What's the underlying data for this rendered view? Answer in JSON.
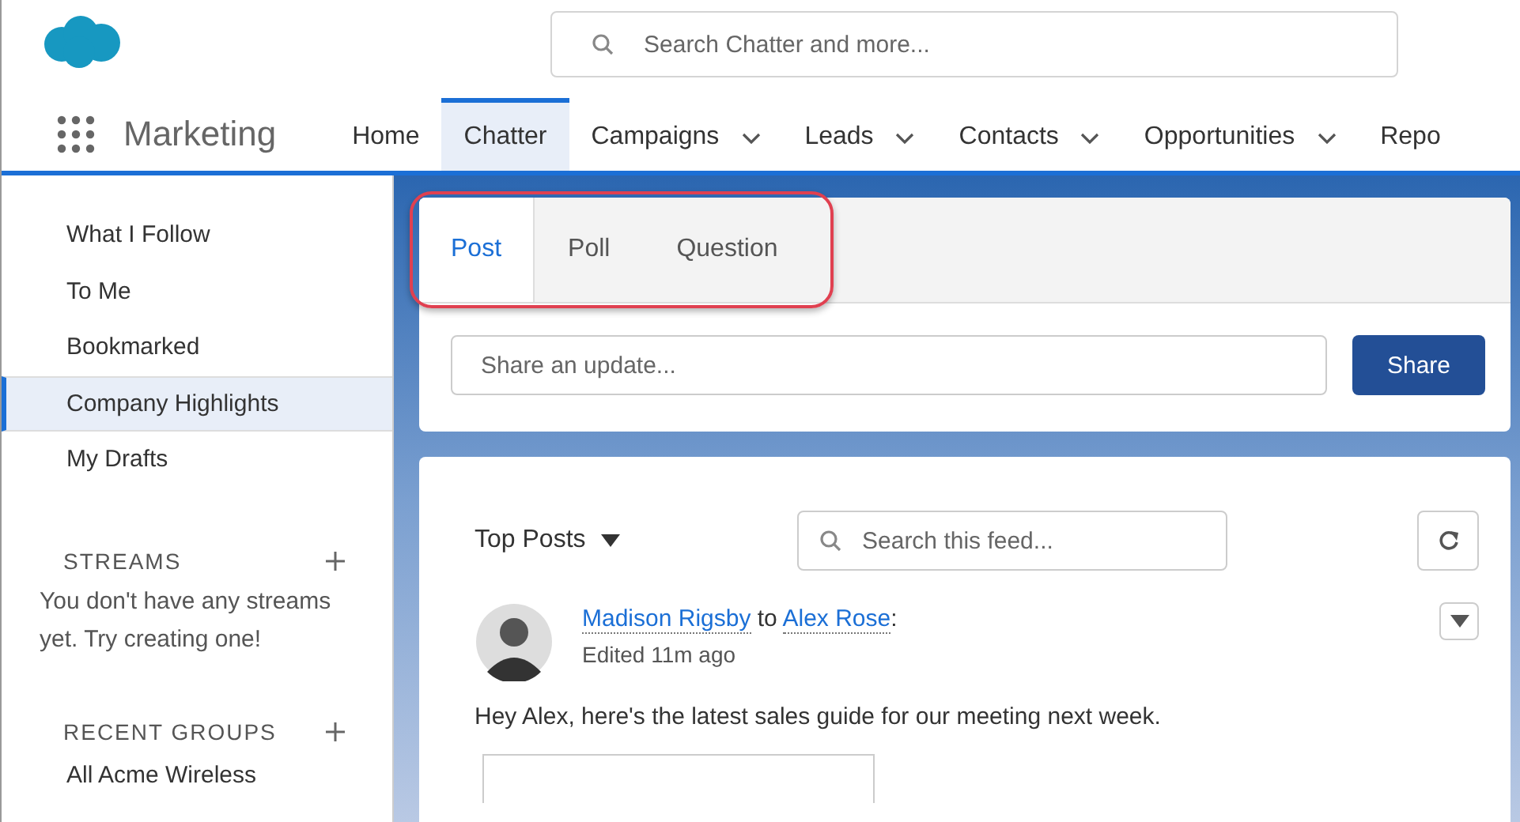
{
  "header": {
    "search": {
      "placeholder": "Search Chatter and more..."
    }
  },
  "app": {
    "name": "Marketing"
  },
  "nav": [
    {
      "label": "Home",
      "selected": false,
      "has_menu": false
    },
    {
      "label": "Chatter",
      "selected": true,
      "has_menu": false
    },
    {
      "label": "Campaigns",
      "selected": false,
      "has_menu": true
    },
    {
      "label": "Leads",
      "selected": false,
      "has_menu": true
    },
    {
      "label": "Contacts",
      "selected": false,
      "has_menu": true
    },
    {
      "label": "Opportunities",
      "selected": false,
      "has_menu": true
    },
    {
      "label": "Repo",
      "selected": false,
      "has_menu": false
    }
  ],
  "sidebar": {
    "items": [
      {
        "label": "What I Follow",
        "selected": false
      },
      {
        "label": "To Me",
        "selected": false
      },
      {
        "label": "Bookmarked",
        "selected": false
      },
      {
        "label": "Company Highlights",
        "selected": true
      },
      {
        "label": "My Drafts",
        "selected": false
      }
    ],
    "sections": [
      {
        "title": "STREAMS",
        "text": "You don't have any streams yet. Try creating one!"
      },
      {
        "title": "RECENT GROUPS",
        "items": [
          "All Acme Wireless"
        ]
      }
    ]
  },
  "publisher": {
    "tabs": [
      {
        "label": "Post",
        "selected": true
      },
      {
        "label": "Poll",
        "selected": false
      },
      {
        "label": "Question",
        "selected": false
      }
    ],
    "input": {
      "placeholder": "Share an update..."
    },
    "button": "Share"
  },
  "feed": {
    "sort": "Top Posts",
    "search": {
      "placeholder": "Search this feed..."
    },
    "posts": [
      {
        "author": "Madison Rigsby",
        "connector": "to",
        "recipient": "Alex Rose",
        "suffix": ":",
        "meta": "Edited 11m ago",
        "body": "Hey Alex, here's the latest sales guide for our meeting next week."
      }
    ]
  }
}
